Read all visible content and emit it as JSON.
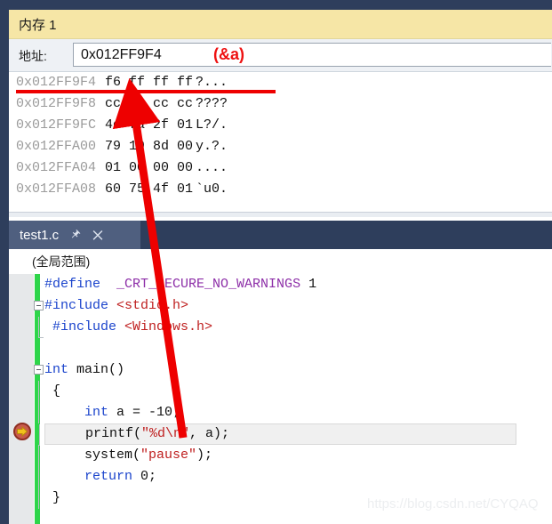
{
  "memory_window": {
    "tab_label": "内存 1",
    "address": {
      "label": "地址:",
      "value": "0x012FF9F4",
      "placeholder": "",
      "annotation": "(&a)"
    },
    "columns": [
      "address",
      "bytes",
      "ascii"
    ],
    "rows": [
      {
        "address": "0x012FF9F4",
        "bytes": "f6 ff ff ff",
        "ascii": "?..."
      },
      {
        "address": "0x012FF9F8",
        "bytes": "cc cc cc cc",
        "ascii": "????"
      },
      {
        "address": "0x012FF9FC",
        "bytes": "4c fa 2f 01",
        "ascii": "L?/."
      },
      {
        "address": "0x012FFA00",
        "bytes": "79 19 8d 00",
        "ascii": "y.?."
      },
      {
        "address": "0x012FFA04",
        "bytes": "01 00 00 00",
        "ascii": "...."
      },
      {
        "address": "0x012FFA08",
        "bytes": "60 75 4f 01",
        "ascii": "`u0."
      }
    ]
  },
  "editor_window": {
    "tab": {
      "label": "test1.c",
      "pin_icon": "pin-icon",
      "close_icon": "close-icon"
    },
    "scope": {
      "value": "(全局范围)"
    },
    "code": [
      {
        "indent": 2,
        "tokens": [
          {
            "t": "#define",
            "c": "pre"
          },
          {
            "t": "  ",
            "c": "plain"
          },
          {
            "t": "_CRT_SECURE_NO_WARNINGS",
            "c": "macro"
          },
          {
            "t": " 1",
            "c": "plain"
          }
        ]
      },
      {
        "indent": 0,
        "fold": "open",
        "tokens": [
          {
            "t": "#include",
            "c": "pre"
          },
          {
            "t": " ",
            "c": "plain"
          },
          {
            "t": "<stdio.h>",
            "c": "str"
          }
        ]
      },
      {
        "indent": 0,
        "stem": "end",
        "tokens": [
          {
            "t": " #include",
            "c": "pre"
          },
          {
            "t": " ",
            "c": "plain"
          },
          {
            "t": "<Windows.h>",
            "c": "str"
          }
        ]
      },
      {
        "indent": 0,
        "tokens": [
          {
            "t": "",
            "c": "plain"
          }
        ]
      },
      {
        "indent": 0,
        "fold": "open",
        "tokens": [
          {
            "t": "int",
            "c": "kw"
          },
          {
            "t": " main()",
            "c": "plain"
          }
        ]
      },
      {
        "indent": 0,
        "stem": "mid",
        "tokens": [
          {
            "t": " {",
            "c": "plain"
          }
        ]
      },
      {
        "indent": 0,
        "stem": "mid",
        "tokens": [
          {
            "t": "     ",
            "c": "plain"
          },
          {
            "t": "int",
            "c": "kw"
          },
          {
            "t": " a = -10;",
            "c": "plain"
          }
        ]
      },
      {
        "indent": 0,
        "stem": "mid",
        "highlight": true,
        "tokens": [
          {
            "t": "     printf(",
            "c": "plain"
          },
          {
            "t": "\"%d\\n\"",
            "c": "str"
          },
          {
            "t": ", a);",
            "c": "plain"
          }
        ]
      },
      {
        "indent": 0,
        "stem": "mid",
        "tokens": [
          {
            "t": "     system(",
            "c": "plain"
          },
          {
            "t": "\"pause\"",
            "c": "str"
          },
          {
            "t": ");",
            "c": "plain"
          }
        ]
      },
      {
        "indent": 0,
        "stem": "mid",
        "tokens": [
          {
            "t": "     ",
            "c": "plain"
          },
          {
            "t": "return",
            "c": "kw"
          },
          {
            "t": " 0;",
            "c": "plain"
          }
        ]
      },
      {
        "indent": 0,
        "stem": "mid",
        "tokens": [
          {
            "t": " }",
            "c": "plain"
          }
        ]
      }
    ],
    "breakpoint_marker": "breakpoint-current-statement-icon"
  },
  "annotations": {
    "arrow_color": "#ee0000",
    "underline_color": "#ee0000"
  },
  "watermark": "https://blog.csdn.net/CYQAQ",
  "colors": {
    "chrome": "#2e3e5c",
    "memory_tab": "#f6e6a6",
    "editor_tab": "#4f5f7f",
    "change_bar": "#2ed54a",
    "accent_red": "#ee0000",
    "keyword_blue": "#1b44cc",
    "string_red": "#bf2020",
    "macro_purple": "#8d2fa8"
  }
}
